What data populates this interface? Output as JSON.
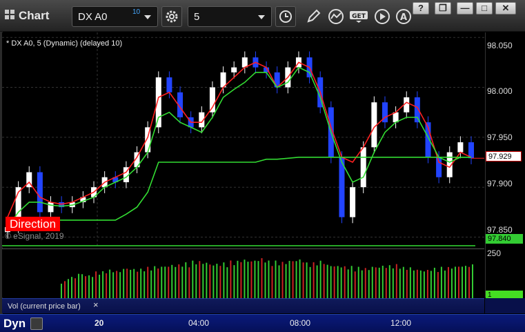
{
  "window": {
    "title": "Chart",
    "buttons": [
      "?",
      "❐",
      "—",
      "□",
      "✕"
    ]
  },
  "toolbar": {
    "symbol": {
      "value": "DX A0",
      "superscript": "10"
    },
    "interval": {
      "value": "5"
    },
    "icons": [
      "settings-gear-icon",
      "clock-icon",
      "pencil-draw-icon",
      "studies-icon",
      "get-icon",
      "play-icon",
      "alerts-icon"
    ]
  },
  "chart": {
    "title": "* DX A0, 5 (Dynamic) (delayed 10)",
    "copyright": "© eSignal, 2019",
    "direction_label": "Direction",
    "price_axis": [
      "98.050",
      "98.000",
      "97.950",
      "97.900",
      "97.850"
    ],
    "current_price": "97.929",
    "green_level": "97.840",
    "volume_axis_top": "250",
    "volume_tag": "1",
    "volume_legend": "Vol (current price bar)",
    "close_legend": "×",
    "time_axis": [
      "20",
      "04:00",
      "08:00",
      "12:00"
    ],
    "pane_label": "Dyn",
    "colors": {
      "up_candle": "#ffffff",
      "down_candle": "#2244ff",
      "red_ma": "#ff2020",
      "green_ma": "#33dd33",
      "vol_up": "#33cc33",
      "vol_down": "#cc2222"
    }
  },
  "chart_data": {
    "type": "line",
    "title": "* DX A0, 5 (Dynamic) (delayed 10)",
    "ylim": [
      97.84,
      98.055
    ],
    "xticks": [
      "20",
      "04:00",
      "08:00",
      "12:00"
    ],
    "series": [
      {
        "color": "#ff2020",
        "values": [
          97.87,
          97.895,
          97.905,
          97.89,
          97.885,
          97.883,
          97.885,
          97.89,
          97.895,
          97.905,
          97.91,
          97.915,
          97.93,
          97.95,
          97.99,
          97.995,
          97.98,
          97.965,
          97.965,
          97.98,
          98.0,
          98.01,
          98.02,
          98.025,
          98.02,
          98.0,
          98.01,
          98.025,
          98.02,
          97.995,
          97.96,
          97.93,
          97.925,
          97.94,
          97.96,
          97.97,
          97.975,
          97.985,
          97.98,
          97.96,
          97.925,
          97.92,
          97.935,
          97.93
        ]
      },
      {
        "color": "#33dd33",
        "values": [
          97.86,
          97.875,
          97.885,
          97.885,
          97.882,
          97.881,
          97.882,
          97.886,
          97.89,
          97.9,
          97.905,
          97.91,
          97.92,
          97.935,
          97.97,
          97.975,
          97.965,
          97.96,
          97.955,
          97.97,
          97.99,
          97.998,
          98.005,
          98.015,
          98.015,
          98.0,
          98.005,
          98.02,
          98.015,
          97.99,
          97.955,
          97.925,
          97.905,
          97.91,
          97.935,
          97.955,
          97.965,
          97.97,
          97.97,
          97.95,
          97.93,
          97.925,
          97.93,
          97.93
        ]
      },
      {
        "color": "#33dd33",
        "values": [
          97.867,
          97.867,
          97.867,
          97.867,
          97.867,
          97.867,
          97.867,
          97.867,
          97.867,
          97.867,
          97.867,
          97.873,
          97.88,
          97.895,
          97.925,
          97.925,
          97.925,
          97.925,
          97.925,
          97.925,
          97.925,
          97.925,
          97.925,
          97.925,
          97.928,
          97.928,
          97.929,
          97.93,
          97.93,
          97.93,
          97.93,
          97.93,
          97.93,
          97.93,
          97.93,
          97.93,
          97.93,
          97.93,
          97.93,
          97.93,
          97.93,
          97.93,
          97.93,
          97.93
        ]
      }
    ],
    "closes": [
      97.86,
      97.9,
      97.915,
      97.875,
      97.885,
      97.88,
      97.885,
      97.89,
      97.9,
      97.91,
      97.905,
      97.92,
      97.935,
      97.96,
      98.01,
      97.995,
      97.97,
      97.96,
      97.975,
      98.0,
      98.015,
      98.02,
      98.03,
      98.02,
      98.015,
      98.0,
      98.02,
      98.03,
      98.01,
      97.98,
      97.93,
      97.87,
      97.9,
      97.94,
      97.985,
      97.965,
      97.975,
      97.99,
      97.965,
      97.93,
      97.91,
      97.935,
      97.945,
      97.929
    ],
    "volume_ylim": [
      0,
      250
    ],
    "volume": [
      95,
      120,
      140,
      130,
      150,
      160,
      155,
      170,
      165,
      175,
      180,
      185,
      190,
      200,
      210,
      205,
      195,
      200,
      210,
      220,
      215,
      225,
      210,
      205,
      215,
      220,
      200,
      210,
      190,
      185,
      180,
      175,
      170,
      180,
      185,
      190,
      175,
      165,
      160,
      170,
      175,
      180,
      185,
      190
    ]
  }
}
